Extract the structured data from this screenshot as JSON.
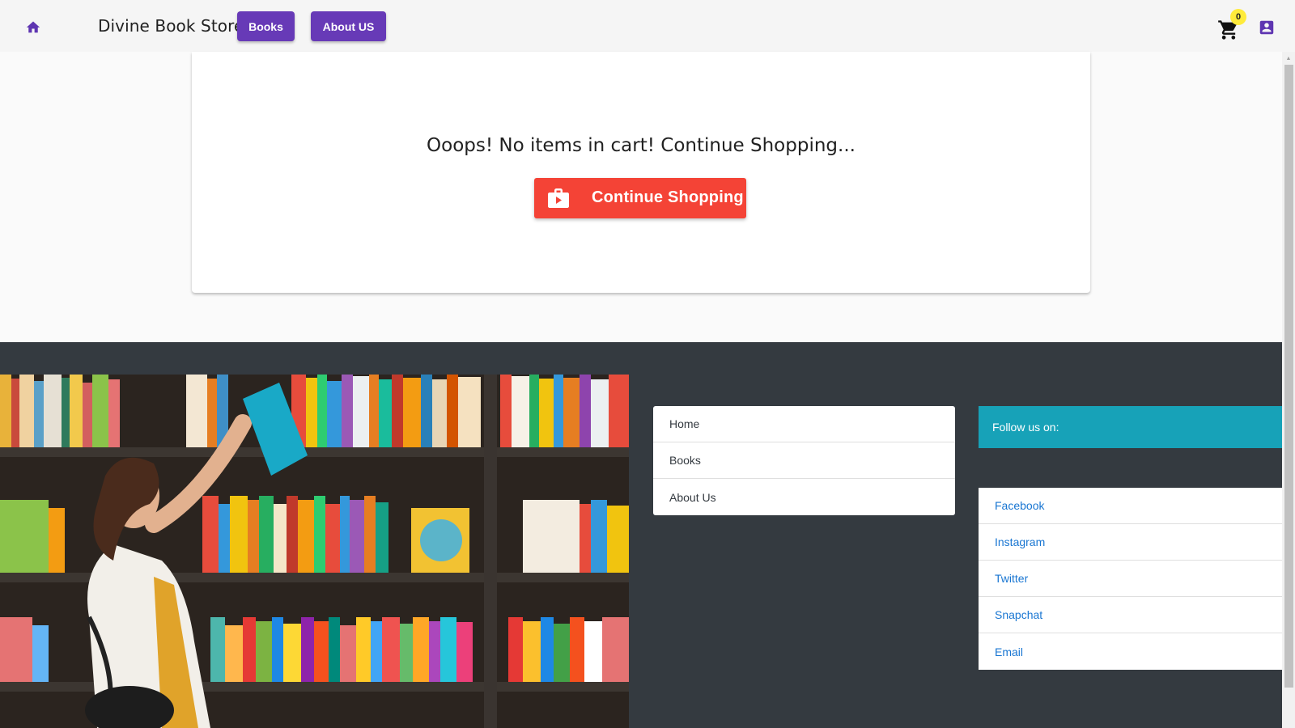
{
  "header": {
    "home_icon": "home-icon",
    "brand": "Divine Book Store",
    "nav": {
      "books_label": "Books",
      "about_label": "About US"
    },
    "cart_icon": "shopping-cart-icon",
    "cart_count": "0",
    "account_icon": "account-box-icon"
  },
  "cart": {
    "empty_message": "Ooops! No items in cart! Continue Shopping...",
    "continue_button": "Continue Shopping",
    "continue_icon": "shop-bag-icon"
  },
  "footer": {
    "nav_links": [
      {
        "label": "Home"
      },
      {
        "label": "Books"
      },
      {
        "label": "About Us"
      }
    ],
    "follow_heading": "Follow us on:",
    "social_links": [
      {
        "label": "Facebook"
      },
      {
        "label": "Instagram"
      },
      {
        "label": "Twitter"
      },
      {
        "label": "Snapchat"
      },
      {
        "label": "Email"
      }
    ]
  },
  "colors": {
    "primary": "#673ab7",
    "accent_red": "#f44336",
    "footer_bg": "#343a40",
    "info": "#17a2b8",
    "link": "#1976d2",
    "badge": "#ffeb3b"
  }
}
